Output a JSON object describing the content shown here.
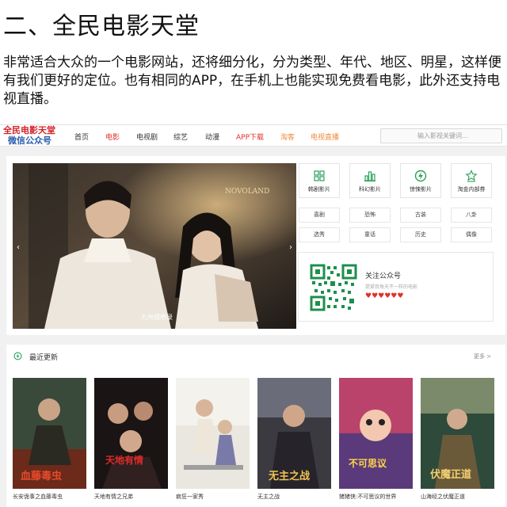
{
  "article": {
    "heading": "二、全民电影天堂",
    "body": "非常适合大众的一个电影网站，还将细分化，分为类型、年代、地区、明星，这样便有我们更好的定位。也有相同的APP，在手机上也能实现免费看电影，此外还支持电视直播。"
  },
  "site": {
    "logo_line1": "全民电影天堂",
    "logo_line2": "微信公众号",
    "nav": [
      "首页",
      "电影",
      "电视剧",
      "综艺",
      "动漫",
      "APP下载",
      "淘客",
      "电视直播"
    ],
    "search_placeholder": "输入影视关键词..."
  },
  "hero": {
    "banner_caption": "九州缥缈录",
    "categories": [
      {
        "label": "韩剧影片",
        "icon": "grid-icon"
      },
      {
        "label": "科幻影片",
        "icon": "bar-chart-icon"
      },
      {
        "label": "惊悚影片",
        "icon": "circle-lightning-icon"
      },
      {
        "label": "淘金内部券",
        "icon": "star-badge-icon"
      }
    ],
    "genres": [
      "喜剧",
      "恐怖",
      "古装",
      "八卦",
      "选秀",
      "童话",
      "历史",
      "偶像"
    ],
    "wechat": {
      "title": "关注公众号",
      "subtitle": "提紧我每天不一样的电影",
      "hearts": "♥♥♥♥♥♥"
    }
  },
  "recent": {
    "title": "最近更新",
    "more": "更多 >",
    "items": [
      {
        "title": "长安诡事之血藤毒虫"
      },
      {
        "title": "天地有情之兄弟"
      },
      {
        "title": "疯狂一家秀"
      },
      {
        "title": "无主之战"
      },
      {
        "title": "猪猪侠:不可思议的世界"
      },
      {
        "title": "山海经之伏魔正道"
      }
    ]
  },
  "colors": {
    "accent_red": "#e0302a",
    "accent_orange": "#f08a3a",
    "accent_green": "#2ea05a",
    "logo_blue": "#2a5cae"
  }
}
